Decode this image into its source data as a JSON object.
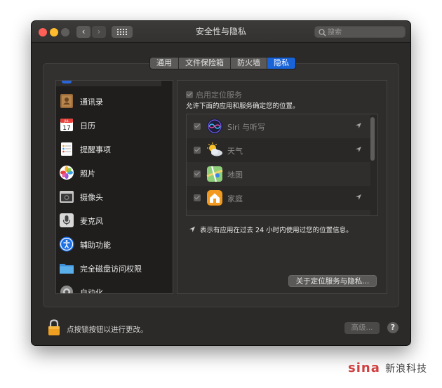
{
  "window": {
    "title": "安全性与隐私",
    "search_placeholder": "搜索"
  },
  "tabs": [
    {
      "label": "通用",
      "active": false
    },
    {
      "label": "文件保险箱",
      "active": false
    },
    {
      "label": "防火墙",
      "active": false
    },
    {
      "label": "隐私",
      "active": true
    }
  ],
  "sidebar": {
    "items": [
      {
        "label": "通讯录",
        "icon": "contacts-icon"
      },
      {
        "label": "日历",
        "icon": "calendar-icon",
        "day": "17",
        "month": "JUL"
      },
      {
        "label": "提醒事项",
        "icon": "reminders-icon"
      },
      {
        "label": "照片",
        "icon": "photos-icon"
      },
      {
        "label": "摄像头",
        "icon": "camera-icon"
      },
      {
        "label": "麦克风",
        "icon": "microphone-icon"
      },
      {
        "label": "辅助功能",
        "icon": "accessibility-icon"
      },
      {
        "label": "完全磁盘访问权限",
        "icon": "folder-icon"
      },
      {
        "label": "自动化",
        "icon": "gear-icon"
      }
    ]
  },
  "location": {
    "enable_label": "启用定位服务",
    "description": "允许下面的应用和服务确定您的位置。",
    "apps": [
      {
        "label": "Siri 与听写",
        "icon": "siri-icon",
        "checked": true,
        "recent": true
      },
      {
        "label": "天气",
        "icon": "weather-icon",
        "checked": true,
        "recent": true
      },
      {
        "label": "地图",
        "icon": "maps-icon",
        "checked": true,
        "recent": false
      },
      {
        "label": "家庭",
        "icon": "home-icon",
        "checked": true,
        "recent": true
      }
    ],
    "hint": "表示有应用在过去 24 小时内使用过您的位置信息。",
    "about_button": "关于定位服务与隐私..."
  },
  "footer": {
    "lock_text": "点按锁按钮以进行更改。",
    "advanced_button": "高级...",
    "help_button": "?"
  },
  "watermark": {
    "brand": "sina",
    "text": "新浪科技"
  }
}
